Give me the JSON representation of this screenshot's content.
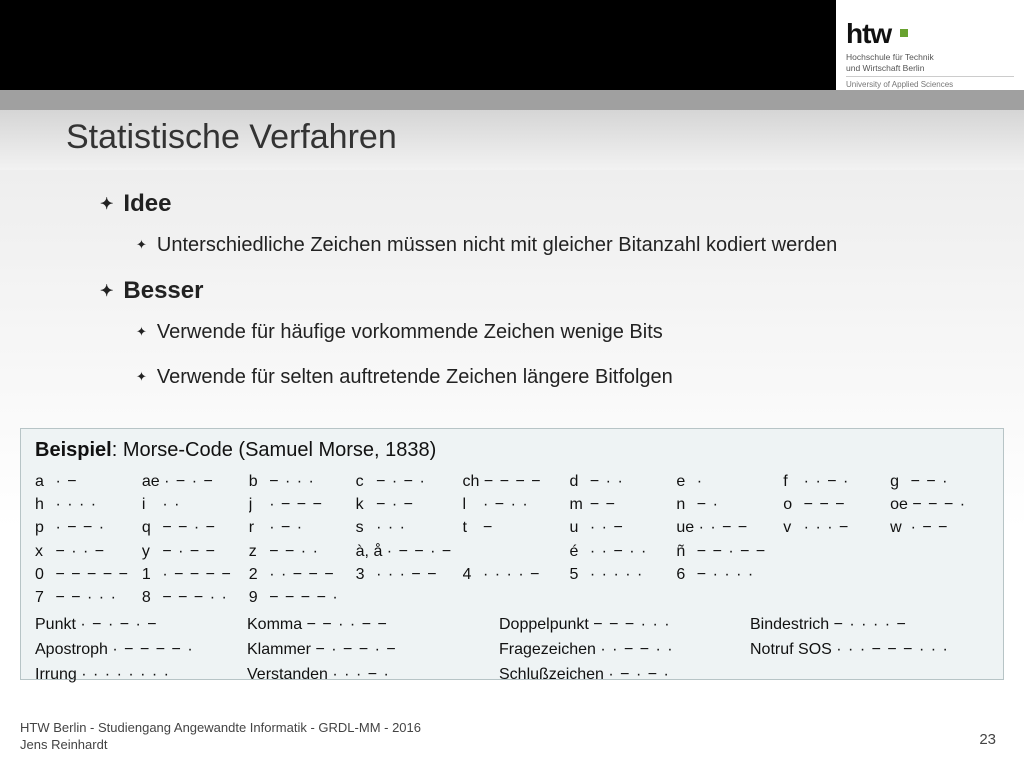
{
  "logo": {
    "brand": "htw",
    "line1": "Hochschule für Technik",
    "line2": "und Wirtschaft Berlin",
    "sub": "University of Applied Sciences"
  },
  "title": "Statistische Verfahren",
  "content": {
    "idee_label": "Idee",
    "idee_item": "Unterschiedliche Zeichen müssen nicht mit gleicher Bitanzahl kodiert werden",
    "besser_label": "Besser",
    "besser_items": [
      "Verwende für häufige vorkommende Zeichen wenige Bits",
      "Verwende für selten auftretende Zeichen längere Bitfolgen"
    ]
  },
  "example": {
    "title_bold": "Beispiel",
    "title_rest": ": Morse-Code (Samuel Morse, 1838)",
    "rows": [
      [
        {
          "s": "a",
          "c": "· −"
        },
        {
          "s": "ae",
          "c": "· − · −"
        },
        {
          "s": "b",
          "c": "− · · ·"
        },
        {
          "s": "c",
          "c": "− · − ·"
        },
        {
          "s": "ch",
          "c": "− − − −"
        },
        {
          "s": "d",
          "c": "− · ·"
        },
        {
          "s": "e",
          "c": "·"
        },
        {
          "s": "f",
          "c": "· · − ·"
        },
        {
          "s": "g",
          "c": "− − ·"
        }
      ],
      [
        {
          "s": "h",
          "c": "· · · ·"
        },
        {
          "s": "i",
          "c": "· ·"
        },
        {
          "s": "j",
          "c": "· − − −"
        },
        {
          "s": "k",
          "c": "− · −"
        },
        {
          "s": "l",
          "c": "· − · ·"
        },
        {
          "s": "m",
          "c": "− −"
        },
        {
          "s": "n",
          "c": "− ·"
        },
        {
          "s": "o",
          "c": "− − −"
        },
        {
          "s": "oe",
          "c": "− − − ·"
        }
      ],
      [
        {
          "s": "p",
          "c": "· − − ·"
        },
        {
          "s": "q",
          "c": "− − · −"
        },
        {
          "s": "r",
          "c": "· − ·"
        },
        {
          "s": "s",
          "c": "· · ·"
        },
        {
          "s": "t",
          "c": "−"
        },
        {
          "s": "u",
          "c": "· · −"
        },
        {
          "s": "ue",
          "c": "· · − −"
        },
        {
          "s": "v",
          "c": "· · · −"
        },
        {
          "s": "w",
          "c": "· − −"
        }
      ],
      [
        {
          "s": "x",
          "c": "− · · −"
        },
        {
          "s": "y",
          "c": "− · − −"
        },
        {
          "s": "z",
          "c": "− − · ·"
        },
        {
          "s": "à, å",
          "c": "· − − · −"
        },
        {
          "s": "",
          "c": ""
        },
        {
          "s": "é",
          "c": "· · − · ·"
        },
        {
          "s": "ñ",
          "c": "− − · − −"
        },
        {
          "s": "",
          "c": ""
        },
        {
          "s": "",
          "c": ""
        }
      ],
      [
        {
          "s": "0",
          "c": "− − − − −"
        },
        {
          "s": "1",
          "c": "· − − − −"
        },
        {
          "s": "2",
          "c": "· · − − −"
        },
        {
          "s": "3",
          "c": "· · · − −"
        },
        {
          "s": "4",
          "c": "· · · · −"
        },
        {
          "s": "5",
          "c": "· · · · ·"
        },
        {
          "s": "6",
          "c": "− · · · ·"
        },
        {
          "s": "",
          "c": ""
        },
        {
          "s": "",
          "c": ""
        }
      ],
      [
        {
          "s": "7",
          "c": "− − · · ·"
        },
        {
          "s": "8",
          "c": "− − − · ·"
        },
        {
          "s": "9",
          "c": "− − − − ·"
        },
        {
          "s": "",
          "c": ""
        },
        {
          "s": "",
          "c": ""
        },
        {
          "s": "",
          "c": ""
        },
        {
          "s": "",
          "c": ""
        },
        {
          "s": "",
          "c": ""
        },
        {
          "s": "",
          "c": ""
        }
      ]
    ],
    "wide": [
      [
        {
          "l": "Punkt",
          "c": "· − · − · −"
        },
        {
          "l": "Komma",
          "c": "− − · · − −"
        },
        {
          "l": "Doppelpunkt",
          "c": "− − − · · ·"
        },
        {
          "l": "Bindestrich",
          "c": "− · · · · −"
        }
      ],
      [
        {
          "l": "Apostroph",
          "c": "· − − − − ·"
        },
        {
          "l": "Klammer",
          "c": "− · − − · −"
        },
        {
          "l": "Fragezeichen",
          "c": "· · − − · ·"
        },
        {
          "l": "Notruf SOS",
          "c": "· · · − − − · · ·"
        }
      ],
      [
        {
          "l": "Irrung",
          "c": "· · · · · · · ·"
        },
        {
          "l": "Verstanden",
          "c": "· · · − ·"
        },
        {
          "l": "Schlußzeichen",
          "c": "· − · − ·"
        },
        {
          "l": "",
          "c": ""
        }
      ]
    ]
  },
  "footer": {
    "line1": "HTW Berlin - Studiengang Angewandte Informatik - GRDL-MM - 2016",
    "line2": "Jens Reinhardt"
  },
  "page": "23"
}
